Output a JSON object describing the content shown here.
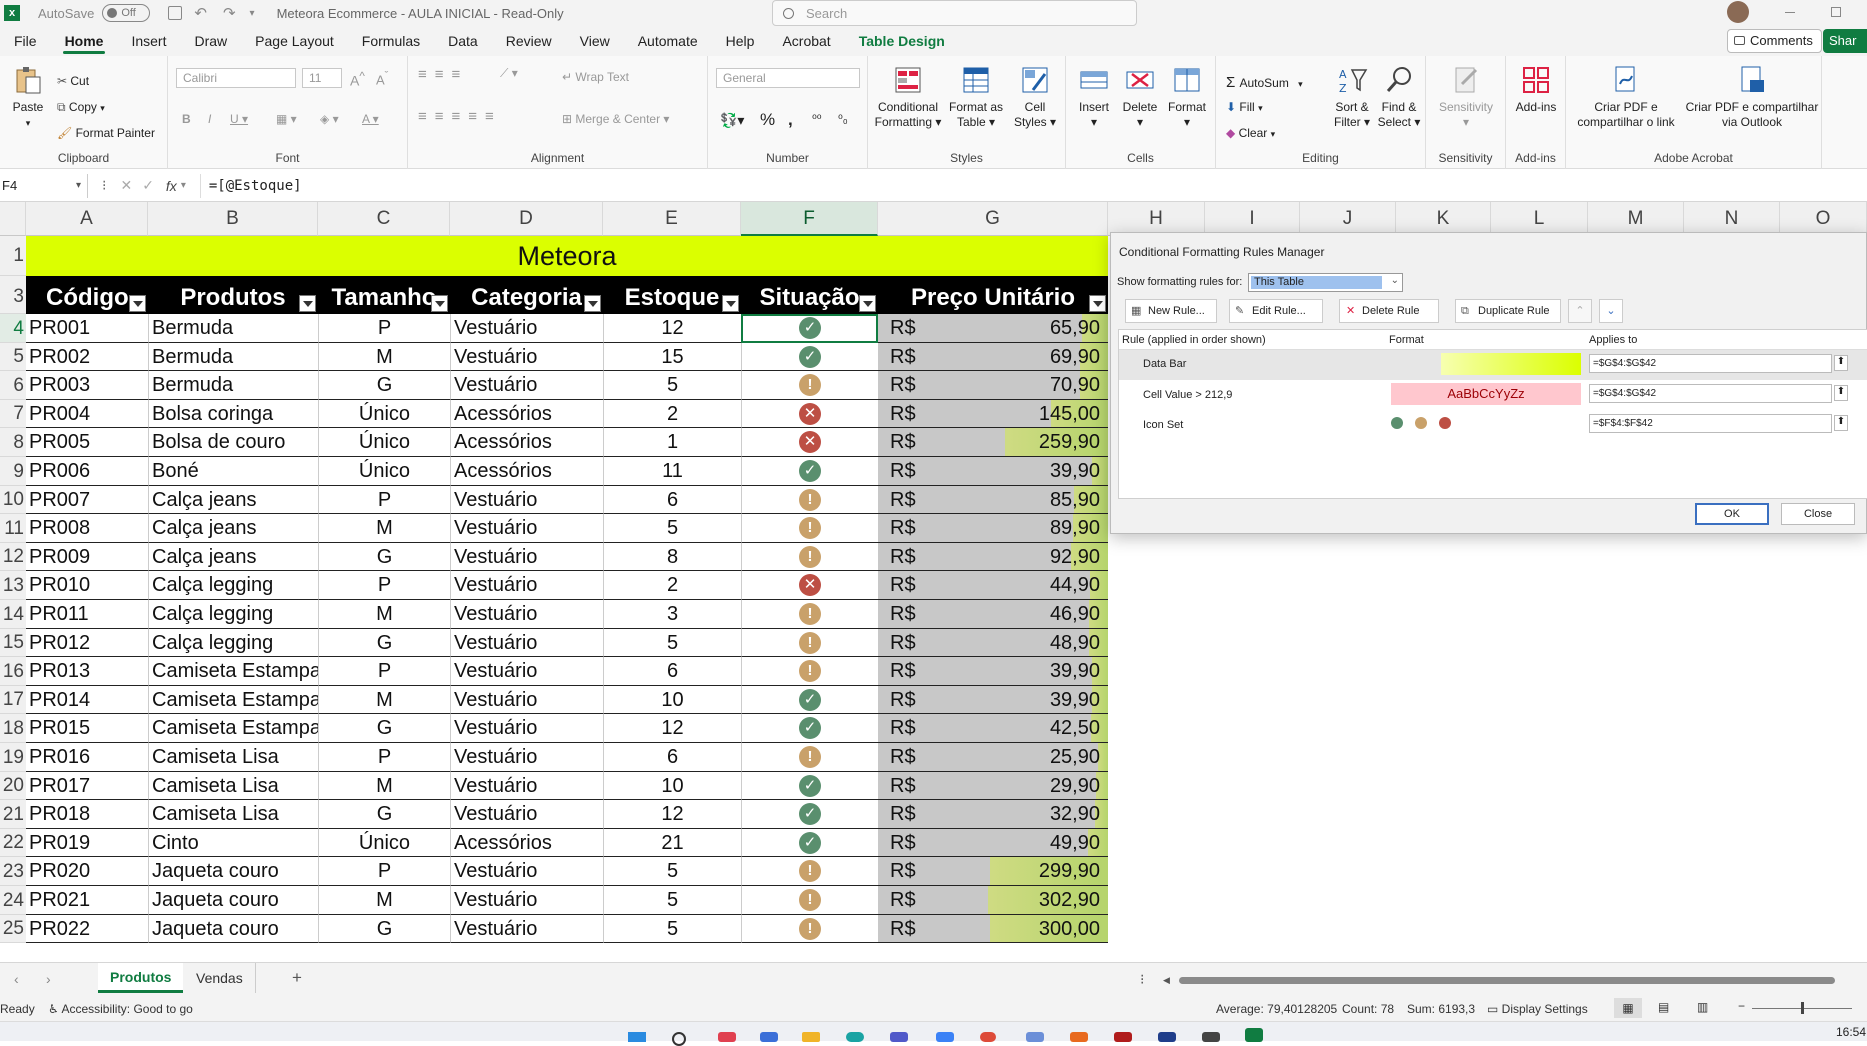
{
  "titlebar": {
    "autosave_label": "AutoSave",
    "autosave_state": "Off",
    "title": "Meteora Ecommerce - AULA INICIAL - Read-Only",
    "search_placeholder": "Search"
  },
  "menu_tabs": [
    "File",
    "Home",
    "Insert",
    "Draw",
    "Page Layout",
    "Formulas",
    "Data",
    "Review",
    "View",
    "Automate",
    "Help",
    "Acrobat",
    "Table Design"
  ],
  "menu_right": {
    "comments": "Comments",
    "share": "Shar"
  },
  "ribbon": {
    "clipboard": {
      "paste": "Paste",
      "cut": "Cut",
      "copy": "Copy",
      "format_painter": "Format Painter",
      "label": "Clipboard"
    },
    "font": {
      "name": "Calibri",
      "size": "11",
      "label": "Font"
    },
    "alignment": {
      "wrap": "Wrap Text",
      "merge": "Merge & Center",
      "label": "Alignment"
    },
    "number": {
      "format": "General",
      "label": "Number"
    },
    "styles": {
      "conditional": "Conditional",
      "conditional2": "Formatting",
      "format_as": "Format as",
      "format_as2": "Table",
      "cell": "Cell",
      "cell2": "Styles",
      "label": "Styles"
    },
    "cells": {
      "insert": "Insert",
      "delete": "Delete",
      "format": "Format",
      "label": "Cells"
    },
    "editing": {
      "autosum": "AutoSum",
      "fill": "Fill",
      "clear": "Clear",
      "sort": "Sort &",
      "sort2": "Filter",
      "find": "Find &",
      "find2": "Select",
      "label": "Editing"
    },
    "sensitivity": {
      "btn": "Sensitivity",
      "label": "Sensitivity"
    },
    "addins": {
      "btn": "Add-ins",
      "label": "Add-ins"
    },
    "acrobat": {
      "pdf1": "Criar PDF e",
      "pdf1b": "compartilhar o link",
      "pdf2": "Criar PDF e compartilhar",
      "pdf2b": "via Outlook",
      "label": "Adobe Acrobat"
    }
  },
  "formula": {
    "namebox": "F4",
    "fx": "fx",
    "content": "=[@Estoque]"
  },
  "columns": [
    "A",
    "B",
    "C",
    "D",
    "E",
    "F",
    "G",
    "H",
    "I",
    "J",
    "K",
    "L",
    "M",
    "N",
    "O"
  ],
  "table": {
    "title": "Meteora",
    "headers": [
      "Código",
      "Produtos",
      "Tamanho",
      "Categoria",
      "Estoque",
      "Situação",
      "Preço Unitário"
    ],
    "currency": "R$",
    "rows": [
      {
        "r": "4",
        "code": "PR001",
        "prod": "Bermuda",
        "size": "P",
        "cat": "Vestuário",
        "stock": "12",
        "status": "ok",
        "price": "65,90",
        "pval": 65.9
      },
      {
        "r": "5",
        "code": "PR002",
        "prod": "Bermuda",
        "size": "M",
        "cat": "Vestuário",
        "stock": "15",
        "status": "ok",
        "price": "69,90",
        "pval": 69.9
      },
      {
        "r": "6",
        "code": "PR003",
        "prod": "Bermuda",
        "size": "G",
        "cat": "Vestuário",
        "stock": "5",
        "status": "warn",
        "price": "70,90",
        "pval": 70.9
      },
      {
        "r": "7",
        "code": "PR004",
        "prod": "Bolsa coringa",
        "size": "Único",
        "cat": "Acessórios",
        "stock": "2",
        "status": "bad",
        "price": "145,00",
        "pval": 145.0
      },
      {
        "r": "8",
        "code": "PR005",
        "prod": "Bolsa de couro",
        "size": "Único",
        "cat": "Acessórios",
        "stock": "1",
        "status": "bad",
        "price": "259,90",
        "pval": 259.9
      },
      {
        "r": "9",
        "code": "PR006",
        "prod": "Boné",
        "size": "Único",
        "cat": "Acessórios",
        "stock": "11",
        "status": "ok",
        "price": "39,90",
        "pval": 39.9
      },
      {
        "r": "10",
        "code": "PR007",
        "prod": "Calça jeans",
        "size": "P",
        "cat": "Vestuário",
        "stock": "6",
        "status": "warn",
        "price": "85,90",
        "pval": 85.9
      },
      {
        "r": "11",
        "code": "PR008",
        "prod": "Calça jeans",
        "size": "M",
        "cat": "Vestuário",
        "stock": "5",
        "status": "warn",
        "price": "89,90",
        "pval": 89.9
      },
      {
        "r": "12",
        "code": "PR009",
        "prod": "Calça jeans",
        "size": "G",
        "cat": "Vestuário",
        "stock": "8",
        "status": "warn",
        "price": "92,90",
        "pval": 92.9
      },
      {
        "r": "13",
        "code": "PR010",
        "prod": "Calça legging",
        "size": "P",
        "cat": "Vestuário",
        "stock": "2",
        "status": "bad",
        "price": "44,90",
        "pval": 44.9
      },
      {
        "r": "14",
        "code": "PR011",
        "prod": "Calça legging",
        "size": "M",
        "cat": "Vestuário",
        "stock": "3",
        "status": "warn",
        "price": "46,90",
        "pval": 46.9
      },
      {
        "r": "15",
        "code": "PR012",
        "prod": "Calça legging",
        "size": "G",
        "cat": "Vestuário",
        "stock": "5",
        "status": "warn",
        "price": "48,90",
        "pval": 48.9
      },
      {
        "r": "16",
        "code": "PR013",
        "prod": "Camiseta Estampa",
        "size": "P",
        "cat": "Vestuário",
        "stock": "6",
        "status": "warn",
        "price": "39,90",
        "pval": 39.9
      },
      {
        "r": "17",
        "code": "PR014",
        "prod": "Camiseta Estampa",
        "size": "M",
        "cat": "Vestuário",
        "stock": "10",
        "status": "ok",
        "price": "39,90",
        "pval": 39.9
      },
      {
        "r": "18",
        "code": "PR015",
        "prod": "Camiseta Estampa",
        "size": "G",
        "cat": "Vestuário",
        "stock": "12",
        "status": "ok",
        "price": "42,50",
        "pval": 42.5
      },
      {
        "r": "19",
        "code": "PR016",
        "prod": "Camiseta Lisa",
        "size": "P",
        "cat": "Vestuário",
        "stock": "6",
        "status": "warn",
        "price": "25,90",
        "pval": 25.9
      },
      {
        "r": "20",
        "code": "PR017",
        "prod": "Camiseta Lisa",
        "size": "M",
        "cat": "Vestuário",
        "stock": "10",
        "status": "ok",
        "price": "29,90",
        "pval": 29.9
      },
      {
        "r": "21",
        "code": "PR018",
        "prod": "Camiseta Lisa",
        "size": "G",
        "cat": "Vestuário",
        "stock": "12",
        "status": "ok",
        "price": "32,90",
        "pval": 32.9
      },
      {
        "r": "22",
        "code": "PR019",
        "prod": "Cinto",
        "size": "Único",
        "cat": "Acessórios",
        "stock": "21",
        "status": "ok",
        "price": "49,90",
        "pval": 49.9
      },
      {
        "r": "23",
        "code": "PR020",
        "prod": "Jaqueta couro",
        "size": "P",
        "cat": "Vestuário",
        "stock": "5",
        "status": "warn",
        "price": "299,90",
        "pval": 299.9
      },
      {
        "r": "24",
        "code": "PR021",
        "prod": "Jaqueta couro",
        "size": "M",
        "cat": "Vestuário",
        "stock": "5",
        "status": "warn",
        "price": "302,90",
        "pval": 302.9
      },
      {
        "r": "25",
        "code": "PR022",
        "prod": "Jaqueta couro",
        "size": "G",
        "cat": "Vestuário",
        "stock": "5",
        "status": "warn",
        "price": "300,00",
        "pval": 300.0
      }
    ]
  },
  "dialog": {
    "title": "Conditional Formatting Rules Manager",
    "show_label": "Show formatting rules for:",
    "show_value": "This Table",
    "new_rule": "New Rule...",
    "edit_rule": "Edit Rule...",
    "delete_rule": "Delete Rule",
    "duplicate_rule": "Duplicate Rule",
    "col_rule": "Rule (applied in order shown)",
    "col_format": "Format",
    "col_applies": "Applies to",
    "rules": [
      {
        "name": "Data Bar",
        "applies": "=$G$4:$G$42"
      },
      {
        "name": "Cell Value > 212,9",
        "sample": "AaBbCcYyZz",
        "applies": "=$G$4:$G$42"
      },
      {
        "name": "Icon Set",
        "applies": "=$F$4:$F$42"
      }
    ],
    "ok": "OK",
    "close": "Close"
  },
  "sheets": [
    "Produtos",
    "Vendas"
  ],
  "status": {
    "ready": "Ready",
    "accessibility": "Accessibility: Good to go",
    "average": "Average: 79,40128205",
    "count": "Count: 78",
    "sum": "Sum: 6193,3",
    "display": "Display Settings"
  },
  "clock": "16:54",
  "colors": {
    "excel_green": "#107c41",
    "title_fill": "#dbff00",
    "databar": "#b5d46c",
    "ok": "#5a8f6e",
    "warn": "#c9a16a",
    "bad": "#bd4f44"
  }
}
